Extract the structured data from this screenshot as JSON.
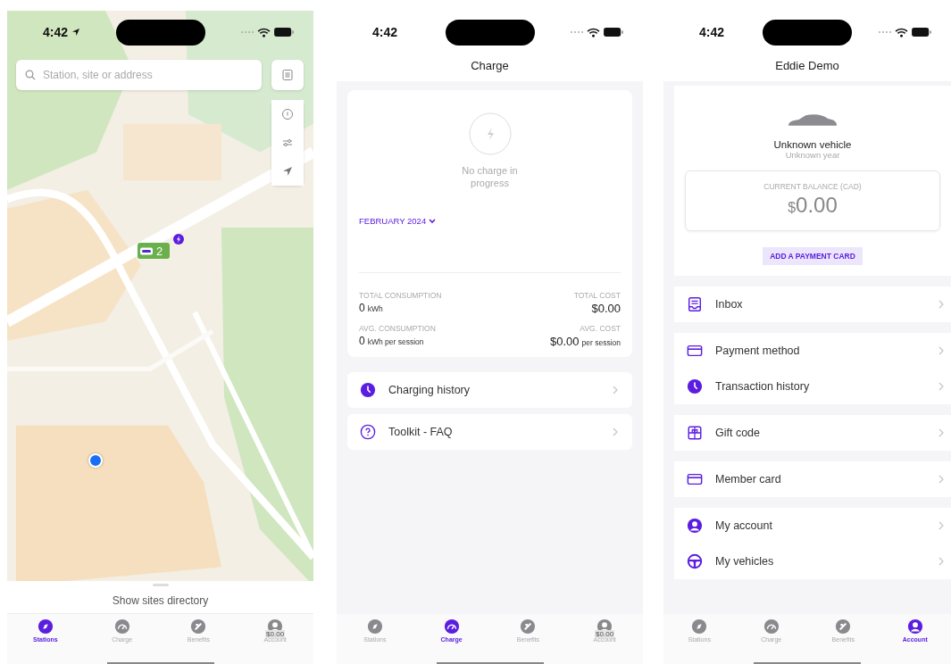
{
  "screens": [
    {
      "kind": "map",
      "status_bar": {
        "time": "4:42",
        "location_arrow": true
      },
      "search": {
        "placeholder": "Station, site or address"
      },
      "map_marker": {
        "count": "2"
      },
      "sheet": {
        "label": "Show sites directory"
      },
      "tabs": [
        {
          "label": "Stations",
          "selected": true
        },
        {
          "label": "Charge",
          "selected": false
        },
        {
          "label": "Benefits",
          "selected": false
        },
        {
          "label": "Account",
          "badge": "$0.00",
          "selected": false
        }
      ]
    },
    {
      "kind": "charge",
      "status_bar": {
        "time": "4:42"
      },
      "title": "Charge",
      "status_text": "No charge in progress",
      "month": "FEBRUARY 2024",
      "stats": [
        {
          "label": "TOTAL CONSUMPTION",
          "value": "0",
          "unit": "kWh"
        },
        {
          "label": "TOTAL COST",
          "value": "$0.00"
        },
        {
          "label": "AVG. CONSUMPTION",
          "value": "0",
          "unit": "kWh per session"
        },
        {
          "label": "AVG. COST",
          "value": "$0.00",
          "unit": "per session"
        }
      ],
      "menu": [
        [
          {
            "label": "Charging history",
            "kind": "clock"
          }
        ],
        [
          {
            "label": "Toolkit - FAQ",
            "kind": "question"
          }
        ]
      ],
      "tabs": [
        {
          "label": "Stations",
          "selected": false
        },
        {
          "label": "Charge",
          "selected": true
        },
        {
          "label": "Benefits",
          "selected": false
        },
        {
          "label": "Account",
          "badge": "$0.00",
          "selected": false
        }
      ]
    },
    {
      "kind": "account",
      "status_bar": {
        "time": "4:42"
      },
      "title": "Eddie Demo",
      "vehicle": {
        "name": "Unknown vehicle",
        "year": "Unknown year"
      },
      "balance": {
        "label": "CURRENT BALANCE (CAD)",
        "currency": "$",
        "amount": "0.00"
      },
      "action": "ADD A PAYMENT CARD",
      "menu": [
        [
          {
            "label": "Inbox",
            "kind": "inbox"
          }
        ],
        [
          {
            "label": "Payment method",
            "kind": "card"
          },
          {
            "label": "Transaction history",
            "kind": "clock"
          }
        ],
        [
          {
            "label": "Gift code",
            "kind": "gift"
          }
        ],
        [
          {
            "label": "Member card",
            "kind": "card"
          }
        ],
        [
          {
            "label": "My account",
            "kind": "user"
          },
          {
            "label": "My vehicles",
            "kind": "wheel"
          }
        ]
      ],
      "tabs": [
        {
          "label": "Stations",
          "selected": false
        },
        {
          "label": "Charge",
          "selected": false
        },
        {
          "label": "Benefits",
          "selected": false
        },
        {
          "label": "Account",
          "selected": true
        }
      ]
    }
  ]
}
